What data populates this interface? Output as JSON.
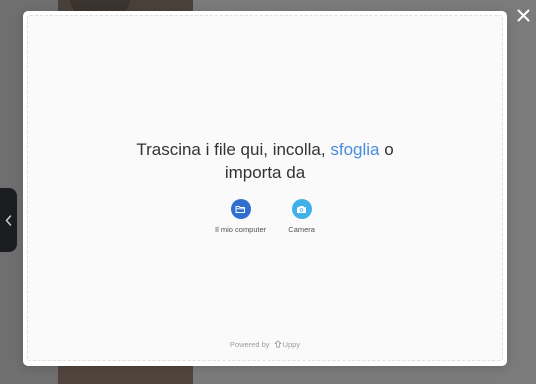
{
  "dropzone": {
    "title_before": "Trascina i file qui, incolla, ",
    "browse_label": "sfoglia",
    "title_after": " o importa da"
  },
  "sources": [
    {
      "label": "Il mio computer",
      "icon": "folder-icon",
      "color": "#2f6fd0"
    },
    {
      "label": "Camera",
      "icon": "camera-icon",
      "color": "#3fb0e8"
    }
  ],
  "footer": {
    "powered_by": "Powered by",
    "brand": "Uppy"
  },
  "icons": {
    "close": "close-icon",
    "side_toggle": "chevron-left-icon"
  },
  "colors": {
    "browse_link": "#4a8ce0",
    "overlay": "#7b7b7b"
  }
}
